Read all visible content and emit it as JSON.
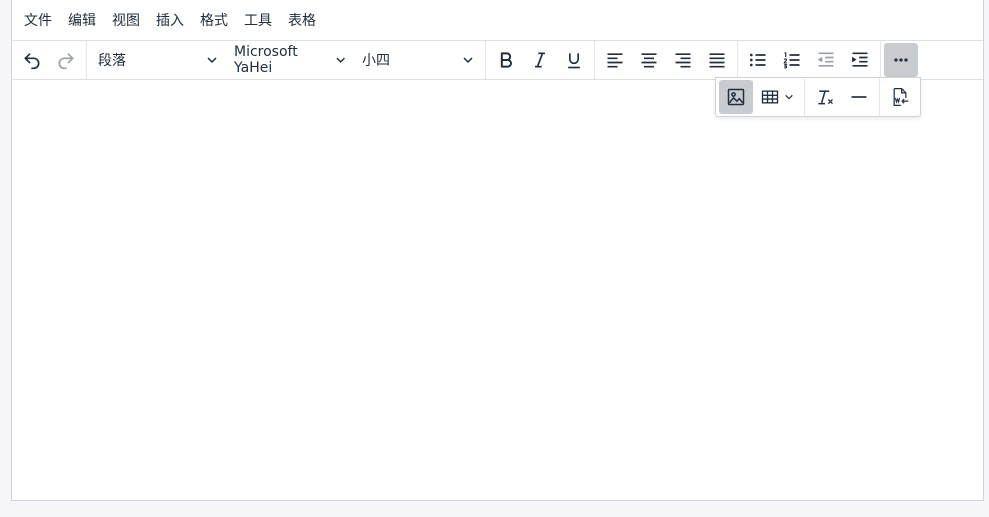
{
  "menubar": {
    "items": [
      "文件",
      "编辑",
      "视图",
      "插入",
      "格式",
      "工具",
      "表格"
    ]
  },
  "toolbar": {
    "block_format": "段落",
    "font_family": "Microsoft YaHei",
    "font_size": "小四"
  },
  "icons": {
    "undo": "undo-icon",
    "redo": "redo-icon",
    "bold": "bold-icon",
    "italic": "italic-icon",
    "underline": "underline-icon",
    "align_left": "align-left-icon",
    "align_center": "align-center-icon",
    "align_right": "align-right-icon",
    "align_justify": "align-justify-icon",
    "bullet_list": "bullet-list-icon",
    "numbered_list": "numbered-list-icon",
    "outdent": "outdent-icon",
    "indent": "indent-icon",
    "more": "more-icon",
    "image": "image-icon",
    "table": "table-icon",
    "remove_format": "remove-format-icon",
    "horizontal_rule": "horizontal-rule-icon",
    "import_word": "import-word-icon"
  },
  "colors": {
    "icon": "#222f3e",
    "active_bg": "#c8cbcf",
    "border": "#cfd4da"
  }
}
